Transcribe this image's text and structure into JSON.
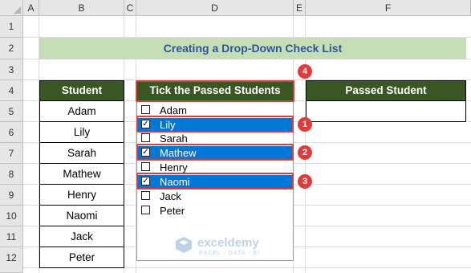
{
  "columns": [
    "A",
    "B",
    "C",
    "D",
    "E",
    "F"
  ],
  "rows": [
    "1",
    "2",
    "3",
    "4",
    "5",
    "6",
    "7",
    "8",
    "9",
    "10",
    "11",
    "12"
  ],
  "title": "Creating a Drop-Down Check List",
  "student_header": "Student",
  "students": [
    "Adam",
    "Lily",
    "Sarah",
    "Mathew",
    "Henry",
    "Naomi",
    "Jack",
    "Peter"
  ],
  "tick_header": "Tick the Passed Students",
  "passed_header": "Passed Student",
  "checklist": [
    {
      "label": "Adam",
      "checked": false,
      "selected": false
    },
    {
      "label": "Lily",
      "checked": true,
      "selected": true
    },
    {
      "label": "Sarah",
      "checked": false,
      "selected": false
    },
    {
      "label": "Mathew",
      "checked": true,
      "selected": true
    },
    {
      "label": "Henry",
      "checked": false,
      "selected": false
    },
    {
      "label": "Naomi",
      "checked": true,
      "selected": true
    },
    {
      "label": "Jack",
      "checked": false,
      "selected": false
    },
    {
      "label": "Peter",
      "checked": false,
      "selected": false
    }
  ],
  "badges": [
    "1",
    "2",
    "3",
    "4"
  ],
  "watermark": {
    "brand": "exceldemy",
    "tagline": "EXCEL · DATA · BI"
  },
  "colors": {
    "header_green": "#385723",
    "title_band": "#c5deb5",
    "title_text": "#2f5597",
    "selection_blue": "#0078d7",
    "callout_red": "#e03b3b"
  }
}
